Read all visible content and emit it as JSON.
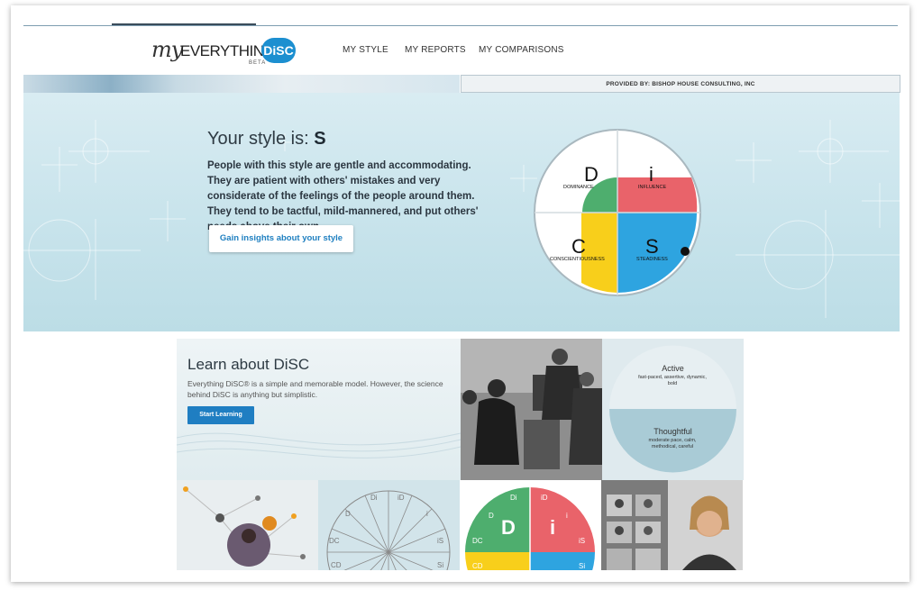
{
  "logo": {
    "my": "my",
    "everything": "EVERYTHING",
    "beta": "BETA",
    "badge": "DiSC"
  },
  "nav": {
    "items": [
      "MY STYLE",
      "MY REPORTS",
      "MY COMPARISONS"
    ]
  },
  "provider": "PROVIDED BY: BISHOP HOUSE CONSULTING, INC",
  "hero": {
    "title_prefix": "Your style is:",
    "style": "S",
    "description": "People with this style are gentle and accommodating. They are patient with others' mistakes and very considerate of the feelings of the people around them. They tend to be tactful, mild-mannered, and put others' needs above their own.",
    "button": "Gain insights about your style"
  },
  "disc_chart": {
    "quadrants": [
      {
        "letter": "D",
        "label": "DOMINANCE",
        "color": "#4eae6e"
      },
      {
        "letter": "i",
        "label": "INFLUENCE",
        "color": "#e9636a"
      },
      {
        "letter": "C",
        "label": "CONSCIENTIOUSNESS",
        "color": "#f8cf1b"
      },
      {
        "letter": "S",
        "label": "STEADINESS",
        "color": "#2ea4e0"
      }
    ]
  },
  "learn": {
    "title": "Learn about DiSC",
    "description": "Everything DiSC® is a simple and memorable model. However, the science behind DiSC is anything but simplistic.",
    "button": "Start Learning"
  },
  "traits": {
    "active": {
      "title": "Active",
      "desc": "fast-paced, assertive, dynamic, bold"
    },
    "thoughtful": {
      "title": "Thoughtful",
      "desc": "moderate pace, calm, methodical, careful"
    }
  },
  "wheel_labels": [
    "Di",
    "iD",
    "D",
    "i",
    "DC",
    "iS",
    "CD",
    "Si"
  ],
  "mini_disc": {
    "labels": [
      "Di",
      "iD",
      "D",
      "i",
      "D",
      "i",
      "DC",
      "iS",
      "CD",
      "Si"
    ]
  },
  "colors": {
    "accent": "#1f7ec2",
    "hero_bg": "#c9e4ec"
  }
}
